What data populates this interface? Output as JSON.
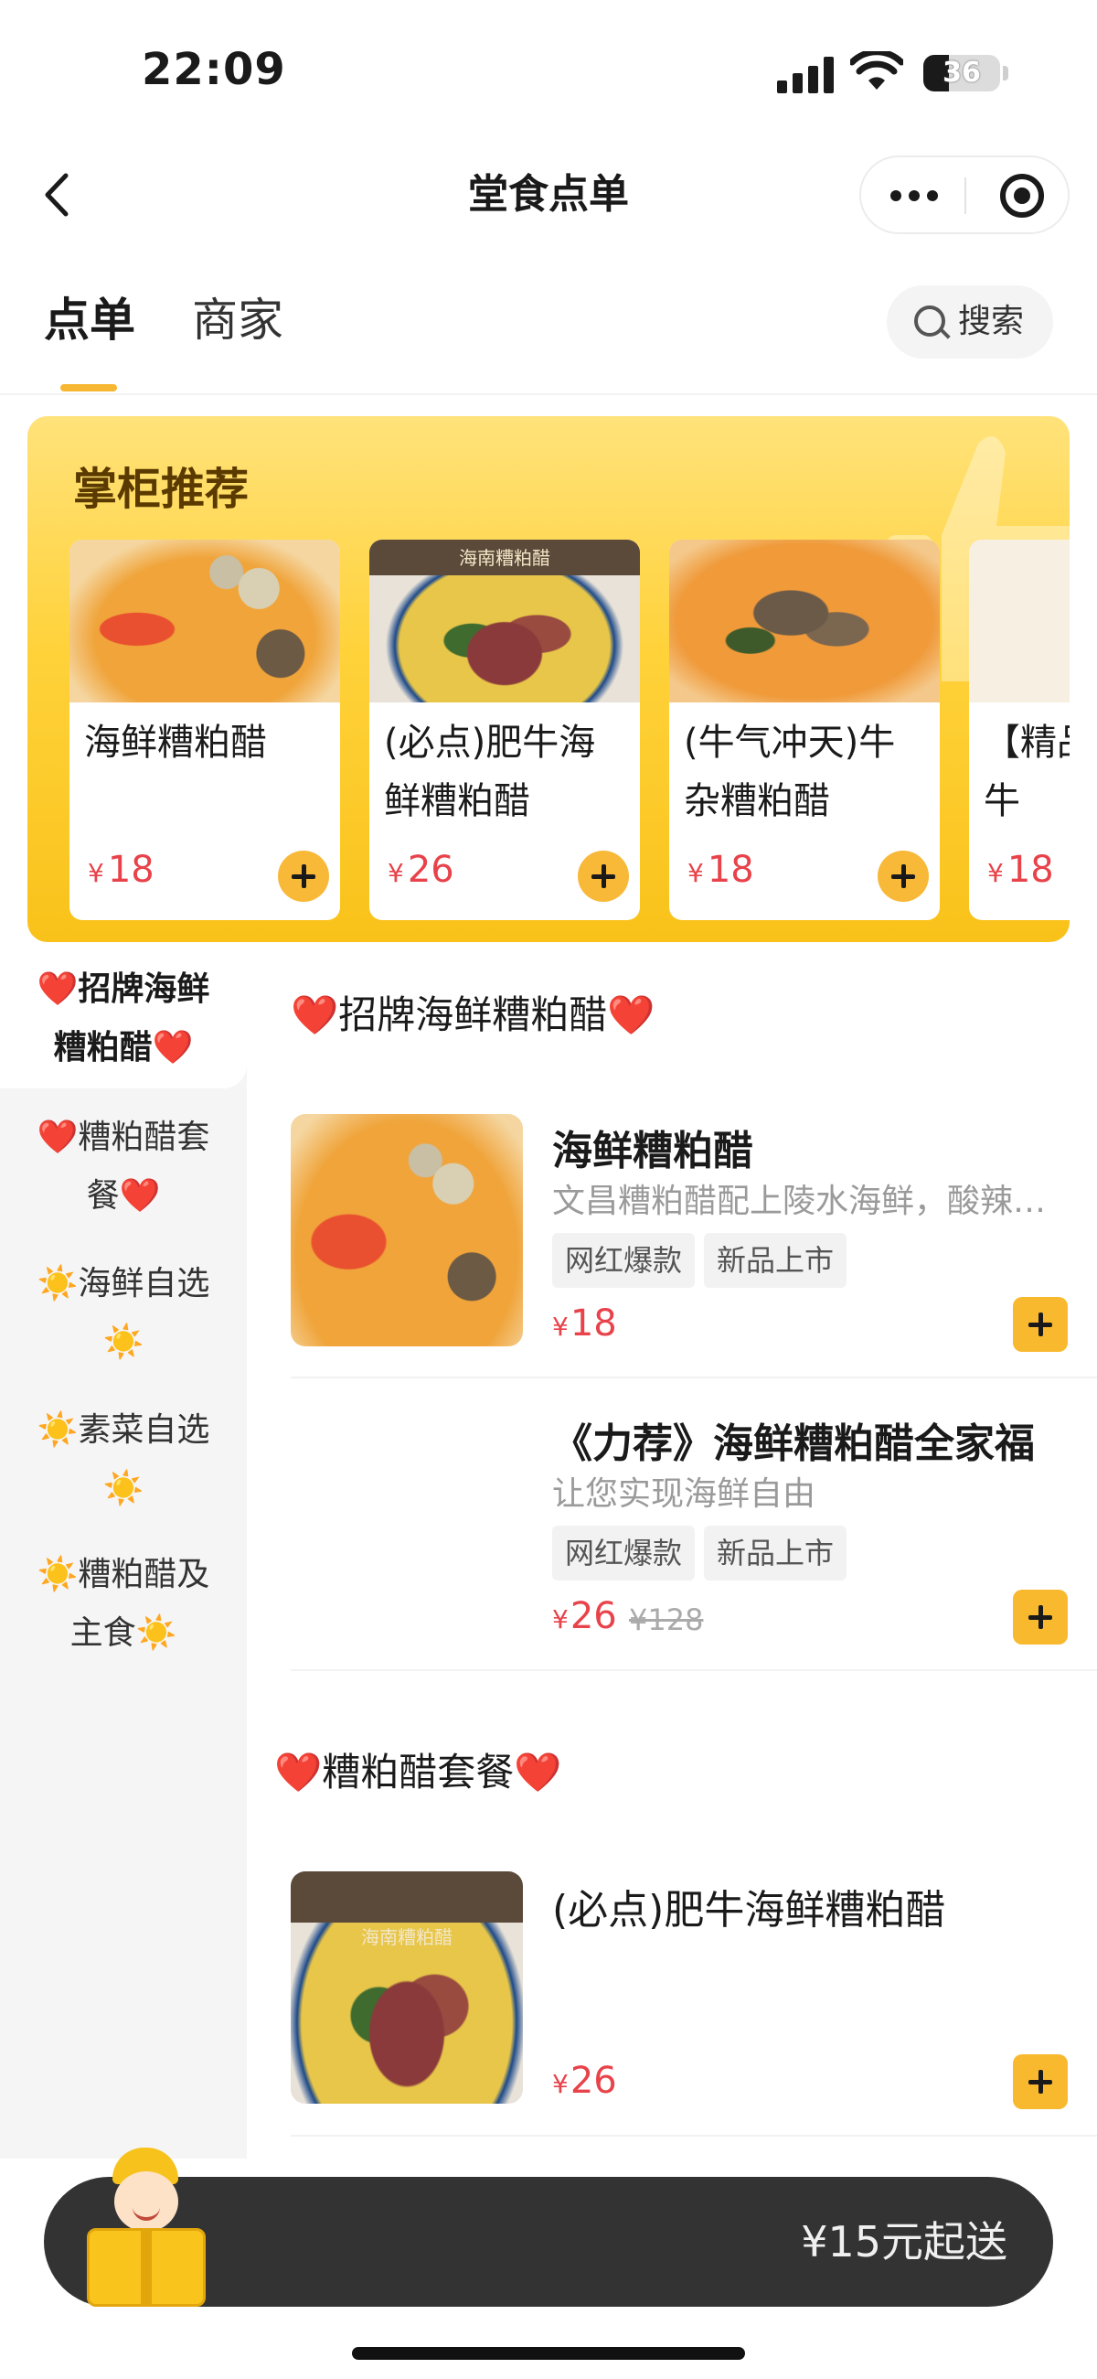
{
  "status_bar": {
    "time": "22:09",
    "battery": "36"
  },
  "nav": {
    "title": "堂食点单"
  },
  "tabs": [
    {
      "label": "点单"
    },
    {
      "label": "商家"
    }
  ],
  "search": {
    "label": "搜索"
  },
  "recommend": {
    "title": "掌柜推荐",
    "items": [
      {
        "name": "海鲜糟粕醋",
        "currency": "¥",
        "price": "18"
      },
      {
        "name": "(必点)肥牛海鲜糟粕醋",
        "currency": "¥",
        "price": "26",
        "image_caption": "海南糟粕醋"
      },
      {
        "name": "(牛气冲天)牛杂糟粕醋",
        "currency": "¥",
        "price": "18"
      },
      {
        "name": "【精品】海鲜牛",
        "currency": "¥",
        "price": "18"
      }
    ]
  },
  "sidebar": {
    "items": [
      {
        "label": "❤️招牌海鲜糟粕醋❤️"
      },
      {
        "label": "❤️糟粕醋套餐❤️"
      },
      {
        "label": "☀️海鲜自选☀️"
      },
      {
        "label": "☀️素菜自选☀️"
      },
      {
        "label": "☀️糟粕醋及主食☀️"
      }
    ]
  },
  "sections": [
    {
      "title": "❤️招牌海鲜糟粕醋❤️",
      "dishes": [
        {
          "name": "海鲜糟粕醋",
          "desc": "文昌糟粕醋配上陵水海鲜，酸辣…",
          "tags": [
            "网红爆款",
            "新品上市"
          ],
          "currency": "¥",
          "price": "18"
        },
        {
          "name": "《力荐》海鲜糟粕醋全家福",
          "desc": "让您实现海鲜自由",
          "tags": [
            "网红爆款",
            "新品上市"
          ],
          "currency": "¥",
          "price": "26",
          "old_price": "¥128"
        }
      ]
    },
    {
      "title": "❤️糟粕醋套餐❤️",
      "dishes": [
        {
          "name": "(必点)肥牛海鲜糟粕醋",
          "currency": "¥",
          "price": "26",
          "image_caption": "海南糟粕醋"
        }
      ]
    }
  ],
  "cart": {
    "min_order": "¥15元起送"
  },
  "colors": {
    "accent": "#f9b92f",
    "price": "#e8424a",
    "cart_bar": "#333333"
  }
}
